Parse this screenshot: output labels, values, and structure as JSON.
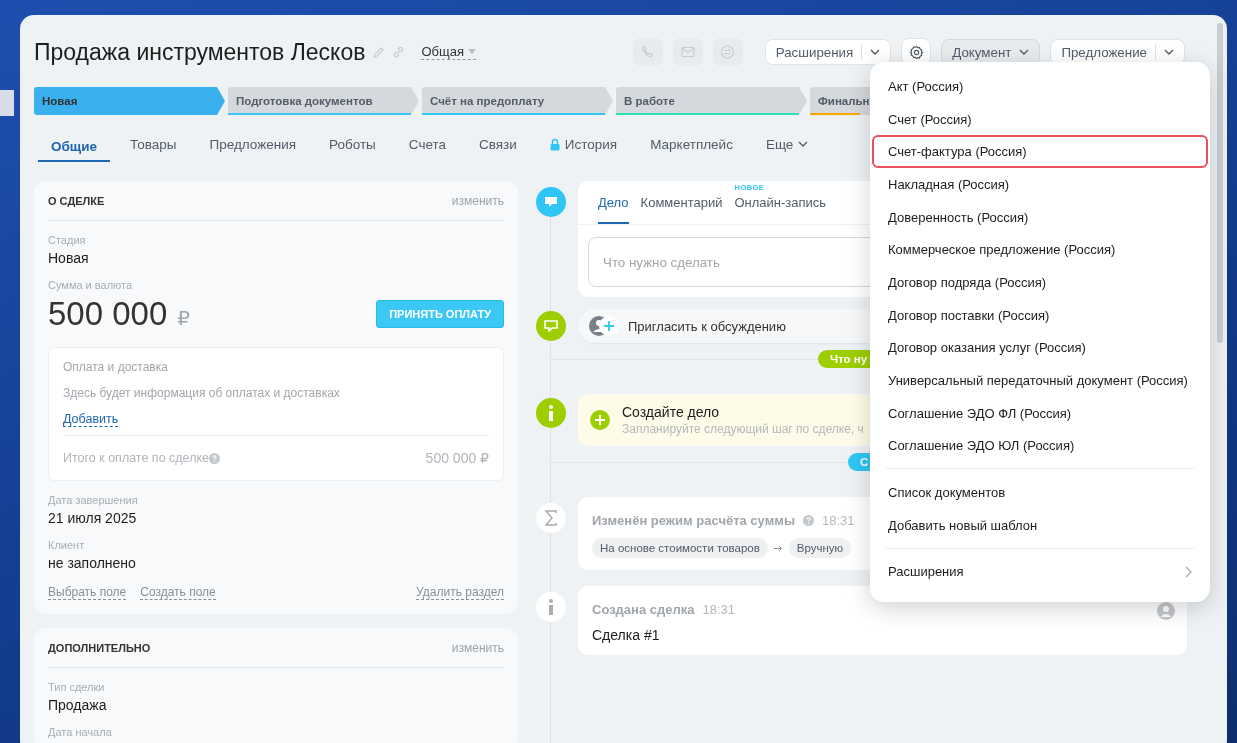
{
  "header": {
    "title": "Продажа инструментов Лесков",
    "category": "Общая",
    "contact_buttons": [
      {
        "disabled": true
      },
      {
        "disabled": true
      },
      {
        "disabled": true
      }
    ],
    "extensions_button": {
      "label": "Расширения"
    },
    "document_button": {
      "label": "Документ",
      "expanded": true
    },
    "offer_button": {
      "label": "Предложение"
    }
  },
  "stages": [
    {
      "label": "Новая",
      "color": "#3bb0ef",
      "selected": true
    },
    {
      "label": "Подготовка документов",
      "color": "#3bc8f5",
      "selected": false
    },
    {
      "label": "Счёт на предоплату",
      "color": "#2fc6f6",
      "selected": false
    },
    {
      "label": "В работе",
      "color": "#2fe0b5",
      "selected": false
    },
    {
      "label": "Финальн",
      "color": "#f7a700",
      "selected": false
    }
  ],
  "tabs": [
    {
      "label": "Общие",
      "kind": "plain",
      "selected": true
    },
    {
      "label": "Товары",
      "kind": "plain",
      "selected": false
    },
    {
      "label": "Предложения",
      "kind": "plain",
      "selected": false
    },
    {
      "label": "Роботы",
      "kind": "plain",
      "selected": false
    },
    {
      "label": "Счета",
      "kind": "plain",
      "selected": false
    },
    {
      "label": "Связи",
      "kind": "plain",
      "selected": false
    },
    {
      "label": "История",
      "kind": "locked",
      "selected": false
    },
    {
      "label": "Маркетплейс",
      "kind": "plain",
      "selected": false
    },
    {
      "label": "Еще",
      "kind": "more",
      "selected": false
    }
  ],
  "deal_card": {
    "title": "О СДЕЛКЕ",
    "edit": "изменить",
    "rows": [
      {
        "kind": "field",
        "label": "Стадия",
        "value": "Новая"
      },
      {
        "kind": "amount",
        "label": "Сумма и валюта",
        "value": "500 000",
        "currency": "₽",
        "button": "ПРИНЯТЬ ОПЛАТУ"
      },
      {
        "kind": "payment",
        "title": "Оплата и доставка",
        "text": "Здесь будет информация об оплатах и доставках",
        "link": "Добавить",
        "total_label": "Итого к оплате по сделке",
        "total": "500 000 ₽"
      },
      {
        "kind": "field",
        "label": "Дата завершения",
        "value": "21 июля 2025"
      },
      {
        "kind": "field",
        "label": "Клиент",
        "value": "не заполнено"
      },
      {
        "kind": "links",
        "links": [
          "Выбрать поле",
          "Создать поле"
        ],
        "remove": "Удалить раздел"
      }
    ]
  },
  "extra_card": {
    "title": "ДОПОЛНИТЕЛЬНО",
    "edit": "изменить",
    "rows": [
      {
        "kind": "field",
        "label": "Тип сделки",
        "value": "Продажа"
      },
      {
        "kind": "field",
        "label": "Дата начала"
      }
    ]
  },
  "timeline": [
    {
      "kind": "composer",
      "tabs": [
        {
          "label": "Дело",
          "selected": true
        },
        {
          "label": "Комментарий",
          "selected": false
        },
        {
          "label": "Онлайн-запись",
          "badge": "НОВОЕ",
          "selected": false
        }
      ],
      "placeholder": "Что нужно сделать"
    },
    {
      "kind": "invite",
      "text": "Пригласить к обсуждению"
    },
    {
      "kind": "divider",
      "pill": "Что ну",
      "color": "#9dcf00"
    },
    {
      "kind": "todo",
      "title": "Создайте дело",
      "text": "Запланируйте следующий шаг по сделке, ч"
    },
    {
      "kind": "divider",
      "pill": "С",
      "color": "#2fc6f6"
    },
    {
      "kind": "change",
      "title": "Изменён режим расчёта суммы",
      "help": true,
      "time": "18:31",
      "chips": [
        "На основе стоимости товаров",
        "Вручную"
      ]
    },
    {
      "kind": "created",
      "title": "Создана сделка",
      "help": false,
      "time": "18:31",
      "text": "Сделка #1"
    }
  ],
  "document_menu": {
    "sections": [
      {
        "items": [
          {
            "label": "Акт (Россия)",
            "selected": false
          },
          {
            "label": "Счет (Россия)",
            "selected": false
          },
          {
            "label": "Счет-фактура (Россия)",
            "selected": true
          },
          {
            "label": "Накладная (Россия)",
            "selected": false
          },
          {
            "label": "Доверенность (Россия)",
            "selected": false
          },
          {
            "label": "Коммерческое предложение (Россия)",
            "selected": false
          },
          {
            "label": "Договор подряда (Россия)",
            "selected": false
          },
          {
            "label": "Договор поставки (Россия)",
            "selected": false
          },
          {
            "label": "Договор оказания услуг (Россия)",
            "selected": false
          },
          {
            "label": "Универсальный передаточный документ (Россия)",
            "selected": false
          },
          {
            "label": "Соглашение ЭДО ФЛ (Россия)",
            "selected": false
          },
          {
            "label": "Соглашение ЭДО ЮЛ (Россия)",
            "selected": false
          }
        ]
      },
      {
        "items": [
          {
            "label": "Список документов",
            "selected": false
          },
          {
            "label": "Добавить новый шаблон",
            "selected": false
          }
        ]
      },
      {
        "items": [
          {
            "label": "Расширения",
            "kind": "submenu",
            "selected": false
          }
        ]
      }
    ]
  }
}
